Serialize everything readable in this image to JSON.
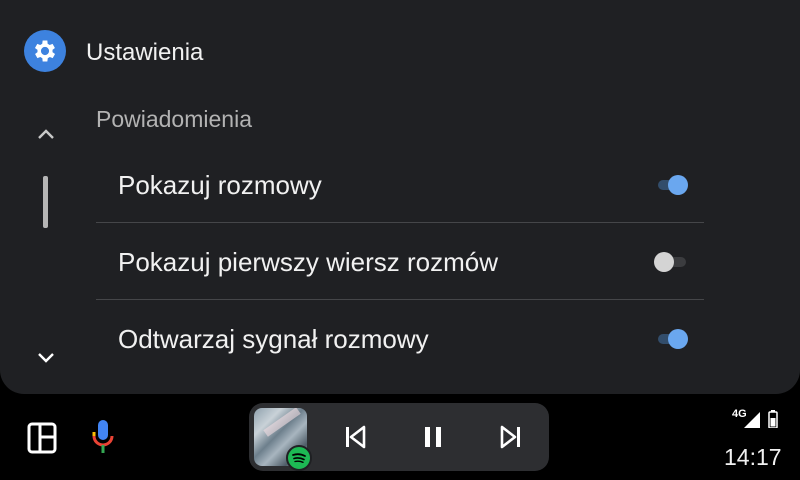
{
  "app": {
    "title": "Ustawienia",
    "icon": "gear-icon",
    "accent": "#3d82df"
  },
  "section": {
    "title": "Powiadomienia"
  },
  "settings": [
    {
      "label": "Pokazuj rozmowy",
      "enabled": true
    },
    {
      "label": "Pokazuj pierwszy wiersz rozmów",
      "enabled": false
    },
    {
      "label": "Odtwarzaj sygnał rozmowy",
      "enabled": true
    }
  ],
  "scroll": {
    "up_icon": "chevron-up-icon",
    "down_icon": "chevron-down-icon"
  },
  "bottom_bar": {
    "launcher_icon": "app-grid-icon",
    "mic_icon": "microphone-icon",
    "media": {
      "source_icon": "spotify-icon",
      "controls": [
        "skip-previous-icon",
        "pause-icon",
        "skip-next-icon"
      ]
    },
    "status": {
      "network": "4G",
      "time": "14:17"
    }
  },
  "colors": {
    "panel": "#1f2023",
    "toggle_on": "#6aa7ef",
    "spotify": "#1db954"
  }
}
